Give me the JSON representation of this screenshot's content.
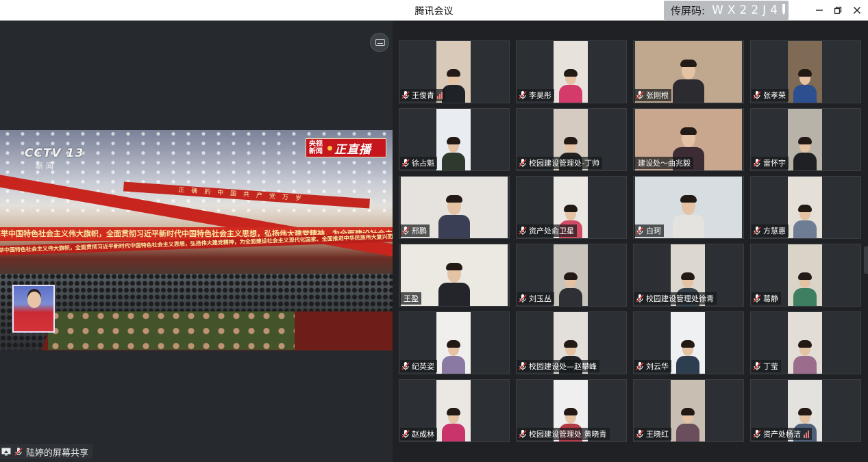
{
  "window": {
    "title": "腾讯会议",
    "share_code_label": "传屏码:",
    "share_code": "WX22J4",
    "min_icon": "minimize-icon",
    "max_icon": "restore-icon",
    "close_icon": "close-icon"
  },
  "share": {
    "label": "陆婷的屏幕共享",
    "broadcast": {
      "channel": "CCTV 13",
      "channel_sub": "新闻",
      "live_small": "央视新闻",
      "live_big": "正直播",
      "banner_main": "高举中国特色社会主义伟大旗帜，全面贯彻习近平新时代中国特色社会主义思想，弘扬伟大建党精神，为全面建设社会主义现代化国家、全面推进中华民族伟大复兴而团结奋斗",
      "banner_top": "正确的中国共产党万岁"
    }
  },
  "colors": {
    "mic_red": "#e23c3c",
    "level_red": "#f07a7a",
    "tile_bg": "#2c2f33"
  },
  "participants": [
    {
      "name": "王俊青",
      "vid": "narrow",
      "bg": "#d8c9b8",
      "shirt": "#1f2226",
      "level": true
    },
    {
      "name": "李昊彤",
      "vid": "narrow",
      "bg": "#e7e2dc",
      "shirt": "#d43b6a",
      "level": false
    },
    {
      "name": "张刚根",
      "vid": "wide",
      "bg": "#bfa88e",
      "shirt": "#2b2b30",
      "level": false
    },
    {
      "name": "张孝荣",
      "vid": "narrow",
      "bg": "#7e6a55",
      "shirt": "#2b4f8f",
      "level": false
    },
    {
      "name": "徐占魁",
      "vid": "narrow",
      "bg": "#e9edf2",
      "shirt": "#2d3a2d",
      "level": false
    },
    {
      "name": "校园建设管理处-丁帅",
      "vid": "narrow",
      "bg": "#d5cbc0",
      "shirt": "#222",
      "level": false
    },
    {
      "name": "建设处～曲兆毅",
      "vid": "wide",
      "bg": "#c9a78f",
      "shirt": "#3e2c34",
      "level": false,
      "no_mic": true
    },
    {
      "name": "雷怀宇",
      "vid": "narrow",
      "bg": "#b7b3a8",
      "shirt": "#1e2023",
      "level": false
    },
    {
      "name": "邢鹏",
      "vid": "wide",
      "bg": "#e6e3df",
      "shirt": "#3a3f55",
      "level": false
    },
    {
      "name": "资产处俞卫星",
      "vid": "narrow",
      "bg": "#ebe8e3",
      "shirt": "#d24b66",
      "level": false
    },
    {
      "name": "白珂",
      "vid": "wide",
      "bg": "#d8dde2",
      "shirt": "#e5e3e0",
      "level": false
    },
    {
      "name": "方慧惠",
      "vid": "narrow",
      "bg": "#e4dfd7",
      "shirt": "#6e7d93",
      "level": false
    },
    {
      "name": "王盈",
      "vid": "wide",
      "bg": "#ece8e2",
      "shirt": "#23252a",
      "level": false,
      "no_mic": true
    },
    {
      "name": "刘玉丛",
      "vid": "narrow",
      "bg": "#c9c4bc",
      "shirt": "#2e3035",
      "level": false
    },
    {
      "name": "校园建设管理处徐青",
      "vid": "narrow",
      "bg": "#dcd7cf",
      "shirt": "#37424d",
      "level": false
    },
    {
      "name": "葛静",
      "vid": "narrow",
      "bg": "#d9d3c8",
      "shirt": "#3e7f62",
      "level": false
    },
    {
      "name": "纪英姿",
      "vid": "narrow",
      "bg": "#f1efed",
      "shirt": "#8a7aa3",
      "level": false
    },
    {
      "name": "校园建设处—赵攀峰",
      "vid": "narrow",
      "bg": "#e3dfda",
      "shirt": "#1f2327",
      "level": false
    },
    {
      "name": "刘云华",
      "vid": "narrow",
      "bg": "#eef0f2",
      "shirt": "#2c3e50",
      "level": false
    },
    {
      "name": "丁莹",
      "vid": "narrow",
      "bg": "#e2ddd6",
      "shirt": "#9b6c8c",
      "level": false
    },
    {
      "name": "赵成林",
      "vid": "narrow",
      "bg": "#ebe7e2",
      "shirt": "#c9356a",
      "level": false
    },
    {
      "name": "校园建设管理处 黄晓青",
      "vid": "narrow",
      "bg": "#efefef",
      "shirt": "#b23b47",
      "level": false
    },
    {
      "name": "王晓红",
      "vid": "narrow",
      "bg": "#c8bfb2",
      "shirt": "#6a4e5c",
      "level": false
    },
    {
      "name": "资产处杨洁",
      "vid": "narrow",
      "bg": "#e4e2de",
      "shirt": "#4d5f79",
      "level": true
    }
  ]
}
